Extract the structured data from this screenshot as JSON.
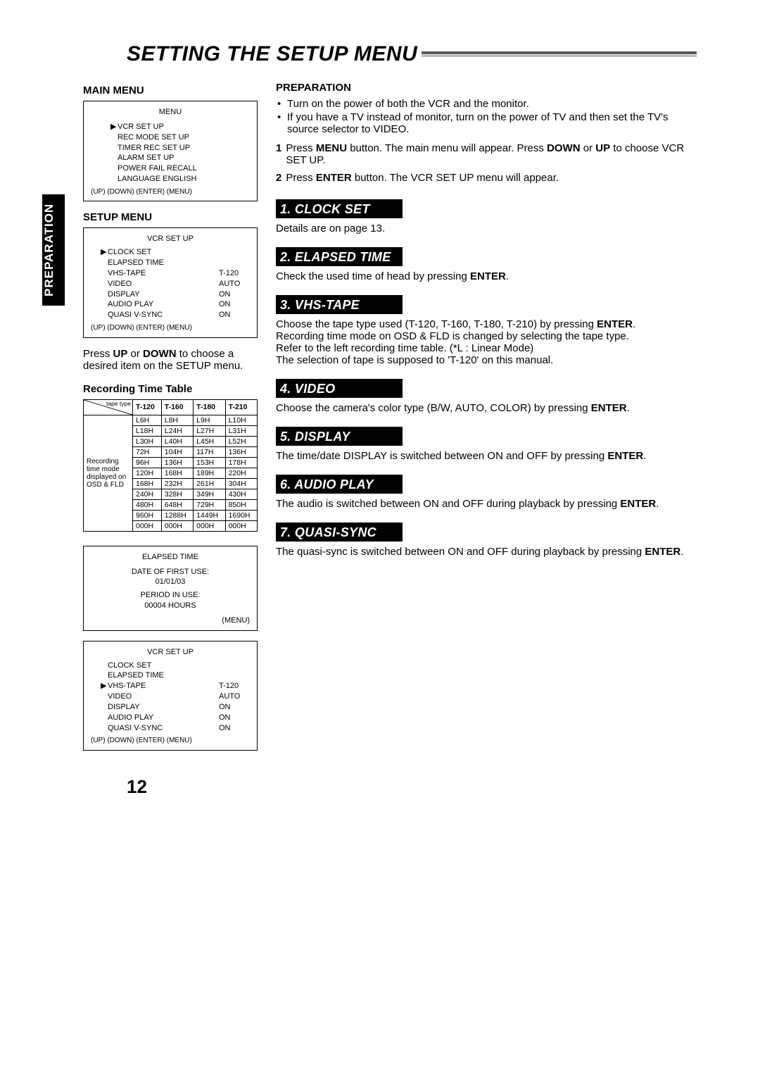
{
  "page_title": "SETTING THE SETUP MENU",
  "side_tab": "PREPARATION",
  "page_number": "12",
  "left": {
    "main_menu_title": "MAIN MENU",
    "main_menu_box": {
      "header": "MENU",
      "items": [
        "VCR SET UP",
        "REC MODE SET UP",
        "TIMER REC SET UP",
        "ALARM SET UP",
        "POWER FAIL RECALL",
        "LANGUAGE  ENGLISH"
      ],
      "footer": "(UP) (DOWN) (ENTER) (MENU)"
    },
    "setup_menu_title": "SETUP MENU",
    "setup_menu_box": {
      "header": "VCR SET UP",
      "rows": [
        {
          "marker": "▶",
          "lbl": "CLOCK SET",
          "val": ""
        },
        {
          "marker": "",
          "lbl": "ELAPSED TIME",
          "val": ""
        },
        {
          "marker": "",
          "lbl": "VHS-TAPE",
          "val": "T-120"
        },
        {
          "marker": "",
          "lbl": "VIDEO",
          "val": "AUTO"
        },
        {
          "marker": "",
          "lbl": "DISPLAY",
          "val": "ON"
        },
        {
          "marker": "",
          "lbl": "AUDIO PLAY",
          "val": "ON"
        },
        {
          "marker": "",
          "lbl": "QUASI V-SYNC",
          "val": "ON"
        }
      ],
      "footer": "(UP) (DOWN) (ENTER) (MENU)"
    },
    "setup_hint_1": "Press ",
    "setup_hint_up": "UP",
    "setup_hint_or": " or ",
    "setup_hint_down": "DOWN",
    "setup_hint_2": " to choose a desired item on the SETUP menu.",
    "rec_table_title": "Recording Time Table",
    "rec_table": {
      "diag_top": "tape type",
      "col_headers": [
        "T-120",
        "T-160",
        "T-180",
        "T-210"
      ],
      "row_label_lines": [
        "Recording",
        "time mode",
        "displayed on",
        "OSD & FLD"
      ],
      "rows": [
        [
          "L6H",
          "L8H",
          "L9H",
          "L10H"
        ],
        [
          "L18H",
          "L24H",
          "L27H",
          "L31H"
        ],
        [
          "L30H",
          "L40H",
          "L45H",
          "L52H"
        ],
        [
          "72H",
          "104H",
          "117H",
          "136H"
        ],
        [
          "96H",
          "136H",
          "153H",
          "178H"
        ],
        [
          "120H",
          "168H",
          "189H",
          "220H"
        ],
        [
          "168H",
          "232H",
          "261H",
          "304H"
        ],
        [
          "240H",
          "328H",
          "349H",
          "430H"
        ],
        [
          "480H",
          "648H",
          "729H",
          "850H"
        ],
        [
          "960H",
          "1288H",
          "1449H",
          "1690H"
        ],
        [
          "000H",
          "000H",
          "000H",
          "000H"
        ]
      ]
    },
    "elapsed_box": {
      "header": "ELAPSED TIME",
      "l1": "DATE OF FIRST USE:",
      "l1v": "01/01/03",
      "l2": "PERIOD IN USE:",
      "l2v": "00004 HOURS",
      "footer": "(MENU)"
    },
    "vcr_box2": {
      "header": "VCR SET UP",
      "rows": [
        {
          "marker": "",
          "lbl": "CLOCK SET",
          "val": ""
        },
        {
          "marker": "",
          "lbl": "ELAPSED TIME",
          "val": ""
        },
        {
          "marker": "▶",
          "lbl": "VHS-TAPE",
          "val": "T-120"
        },
        {
          "marker": "",
          "lbl": "VIDEO",
          "val": "AUTO"
        },
        {
          "marker": "",
          "lbl": "DISPLAY",
          "val": "ON"
        },
        {
          "marker": "",
          "lbl": "AUDIO PLAY",
          "val": "ON"
        },
        {
          "marker": "",
          "lbl": "QUASI V-SYNC",
          "val": "ON"
        }
      ],
      "footer": "(UP) (DOWN) (ENTER) (MENU)"
    }
  },
  "right": {
    "prep_title": "PREPARATION",
    "bullets": [
      "Turn on the power of both the VCR and the monitor.",
      "If you have a TV instead of monitor, turn on the power of TV and then set the TV's source selector to VIDEO."
    ],
    "step1_a": "Press ",
    "step1_menu": "MENU",
    "step1_b": " button. The main menu will appear. Press ",
    "step1_down": "DOWN",
    "step1_or": " or ",
    "step1_up": "UP",
    "step1_c": " to choose VCR SET UP.",
    "step2_a": "Press ",
    "step2_enter": "ENTER",
    "step2_b": " button. The VCR SET UP menu will appear.",
    "sections": {
      "clock_set": {
        "hdr": "1. CLOCK SET",
        "body": "Details are on page 13."
      },
      "elapsed": {
        "hdr": "2. ELAPSED TIME",
        "body_a": "Check the used time of head by pressing ",
        "enter": "ENTER",
        "body_b": "."
      },
      "vhs": {
        "hdr": "3. VHS-TAPE",
        "l1a": "Choose the tape type used (T-120, T-160, T-180, T-210) by pressing ",
        "enter": "ENTER",
        "l1b": ".",
        "l2": "Recording time mode on OSD & FLD is changed by selecting the tape type.",
        "l3": "Refer to the left recording time table. (*L : Linear Mode)",
        "l4": "The selection of tape is supposed to 'T-120' on this manual."
      },
      "video": {
        "hdr": "4. VIDEO",
        "body_a": "Choose the camera's color type (B/W, AUTO, COLOR) by pressing ",
        "enter": "ENTER",
        "body_b": "."
      },
      "display": {
        "hdr": "5. DISPLAY",
        "body_a": "The time/date DISPLAY is switched between ON and OFF by pressing ",
        "enter": "ENTER",
        "body_b": "."
      },
      "audio": {
        "hdr": "6. AUDIO PLAY",
        "body_a": "The audio is switched between ON and OFF during playback by pressing ",
        "enter": "ENTER",
        "body_b": "."
      },
      "quasi": {
        "hdr": "7. QUASI-SYNC",
        "body_a": "The quasi-sync is switched between ON and OFF during playback by pressing ",
        "enter": "ENTER",
        "body_b": "."
      }
    }
  }
}
